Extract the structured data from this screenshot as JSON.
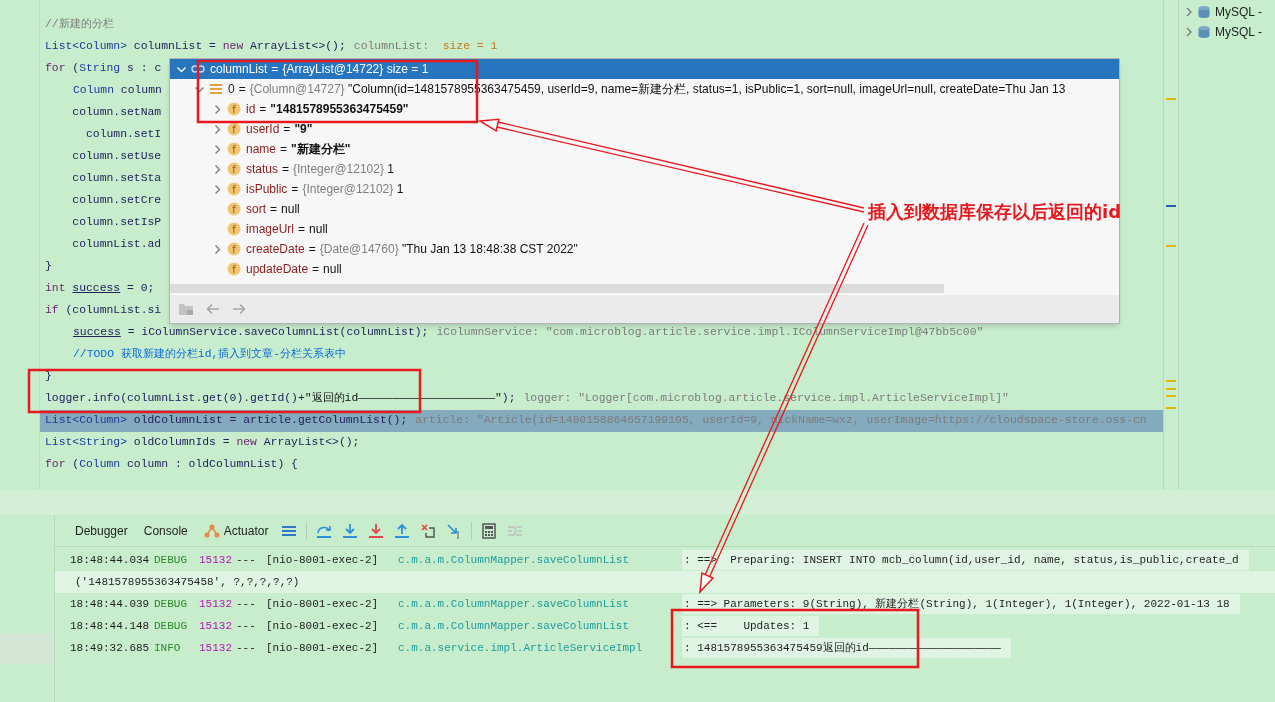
{
  "right_panel": {
    "items": [
      {
        "label": "MySQL -",
        "expanded": false
      },
      {
        "label": "MySQL -",
        "expanded": false
      }
    ]
  },
  "code_lines": [
    {
      "current": false,
      "code": [
        {
          "kind": "comment",
          "text": "//新建的分栏"
        }
      ]
    },
    {
      "current": false,
      "code": [
        {
          "kind": "type",
          "text": "List<Column>"
        },
        {
          "kind": "plain",
          "text": " columnList = "
        },
        {
          "kind": "keyword",
          "text": "new"
        },
        {
          "kind": "plain",
          "text": " ArrayList<>();"
        }
      ],
      "hint": [
        {
          "kind": "hint",
          "text": "columnList:  "
        },
        {
          "kind": "hint_value",
          "text": "size = 1"
        }
      ]
    },
    {
      "current": false,
      "code": [
        {
          "kind": "keyword",
          "text": "for"
        },
        {
          "kind": "plain",
          "text": " ("
        },
        {
          "kind": "type",
          "text": "String"
        },
        {
          "kind": "plain",
          "text": " s : c"
        }
      ]
    },
    {
      "current": false,
      "indented": true,
      "code": [
        {
          "kind": "type",
          "text": "Column"
        },
        {
          "kind": "plain",
          "text": " column"
        }
      ]
    },
    {
      "current": false,
      "code": [
        {
          "kind": "plain",
          "text": "    column.setNam"
        }
      ]
    },
    {
      "current": false,
      "code": [
        {
          "kind": "plain",
          "text": "      column.setI"
        }
      ]
    },
    {
      "current": false,
      "code": [
        {
          "kind": "plain",
          "text": "    column.setUse"
        }
      ]
    },
    {
      "current": false,
      "code": [
        {
          "kind": "plain",
          "text": "    column.setSta"
        }
      ]
    },
    {
      "current": false,
      "code": [
        {
          "kind": "plain",
          "text": "    column.setCre"
        }
      ]
    },
    {
      "current": false,
      "code": [
        {
          "kind": "plain",
          "text": "    column.setIsP"
        }
      ]
    },
    {
      "current": false,
      "code": [
        {
          "kind": "plain",
          "text": "    columnList.ad"
        }
      ]
    },
    {
      "current": false,
      "code": [
        {
          "kind": "plain",
          "text": "}"
        }
      ]
    },
    {
      "current": false,
      "code": [
        {
          "kind": "keyword",
          "text": "int "
        },
        {
          "kind": "underline",
          "text": "success"
        },
        {
          "kind": "plain",
          "text": " = 0;"
        }
      ]
    },
    {
      "current": false,
      "code": [
        {
          "kind": "keyword",
          "text": "if"
        },
        {
          "kind": "plain",
          "text": " (columnList.si"
        }
      ]
    },
    {
      "current": false,
      "indented": true,
      "code": [
        {
          "kind": "underline",
          "text": "success"
        },
        {
          "kind": "plain",
          "text": " = iColumnService.saveColumnList(columnList);"
        }
      ],
      "hint": [
        {
          "kind": "hint",
          "text": "iColumnService: \"com.microblog.article.service.impl.IColumnServiceImpl@47bb5c00\""
        }
      ]
    },
    {
      "current": false,
      "indented": true,
      "code": [
        {
          "kind": "todo",
          "text": "//TODO 获取新建的分栏id,插入到文章-分栏关系表中"
        }
      ]
    },
    {
      "current": false,
      "code": [
        {
          "kind": "plain",
          "text": "}"
        }
      ]
    },
    {
      "current": false,
      "code": [
        {
          "kind": "plain",
          "text": "logger.info(columnList.get(0).getId()+"
        },
        {
          "kind": "string",
          "text": "\"返回的id————————————————————\""
        },
        {
          "kind": "plain",
          "text": ");"
        }
      ],
      "hint": [
        {
          "kind": "hint",
          "text": "logger: \"Logger[com.microblog.article.service.impl.ArticleServiceImpl]\""
        }
      ]
    },
    {
      "current": true,
      "code": [
        {
          "kind": "type",
          "text": "List<Column>"
        },
        {
          "kind": "plain",
          "text": " oldColumnList = article.getColumnList();"
        }
      ],
      "hint": [
        {
          "kind": "hint",
          "text": "article: \"Article(id=1480158864657199105, userId=9, nickName=wxz, userImage=https://cloudspace-store.oss-cn"
        }
      ]
    },
    {
      "current": false,
      "code": [
        {
          "kind": "type",
          "text": "List<String>"
        },
        {
          "kind": "plain",
          "text": " oldColumnIds = "
        },
        {
          "kind": "keyword",
          "text": "new"
        },
        {
          "kind": "plain",
          "text": " ArrayList<>();"
        }
      ]
    },
    {
      "current": false,
      "code": [
        {
          "kind": "keyword",
          "text": "for"
        },
        {
          "kind": "plain",
          "text": " ("
        },
        {
          "kind": "type",
          "text": "Column"
        },
        {
          "kind": "plain",
          "text": " column : oldColumnList) {"
        }
      ]
    }
  ],
  "variables_popup": {
    "root": {
      "kind": "list",
      "name": "columnList",
      "eq": "=",
      "ref": "{ArrayList@14722}",
      "value": "size = 1",
      "expandable": true,
      "expanded": true,
      "children": [
        {
          "kind": "object",
          "name": "0",
          "eq": "=",
          "ref": "{Column@14727}",
          "value": "\"Column(id=1481578955363475459, userId=9, name=新建分栏, status=1, isPublic=1, sort=null, imageUrl=null, createDate=Thu Jan 13",
          "expandable": true,
          "expanded": true,
          "children": [
            {
              "kind": "string_field",
              "badge": "f",
              "name": "id",
              "eq": "=",
              "value": "\"1481578955363475459\"",
              "expandable": true,
              "expanded": false
            },
            {
              "kind": "string_field",
              "badge": "f",
              "name": "userId",
              "eq": "=",
              "value": "\"9\"",
              "expandable": true,
              "expanded": false
            },
            {
              "kind": "string_field",
              "badge": "f",
              "name": "name",
              "eq": "=",
              "value": "\"新建分栏\"",
              "expandable": true,
              "expanded": false
            },
            {
              "kind": "field",
              "badge": "f",
              "name": "status",
              "eq": "=",
              "ref": "{Integer@12102}",
              "value": "1",
              "expandable": true,
              "expanded": false
            },
            {
              "kind": "field",
              "badge": "f",
              "name": "isPublic",
              "eq": "=",
              "ref": "{Integer@12102}",
              "value": "1",
              "expandable": true,
              "expanded": false
            },
            {
              "kind": "field",
              "badge": "f",
              "name": "sort",
              "eq": "=",
              "value": "null",
              "expandable": false
            },
            {
              "kind": "field",
              "badge": "f",
              "name": "imageUrl",
              "eq": "=",
              "value": "null",
              "expandable": false
            },
            {
              "kind": "field",
              "badge": "f",
              "name": "createDate",
              "eq": "=",
              "ref": "{Date@14760}",
              "value": "\"Thu Jan 13 18:48:38 CST 2022\"",
              "expandable": true,
              "expanded": false
            },
            {
              "kind": "field",
              "badge": "f",
              "name": "updateDate",
              "eq": "=",
              "value": "null",
              "expandable": false
            }
          ]
        }
      ]
    }
  },
  "annotation": {
    "label": "插入到数据库保存以后返回的id"
  },
  "debug_panel": {
    "tabs": [
      {
        "label": "Debugger"
      },
      {
        "label": "Console"
      },
      {
        "label": "Actuator",
        "kind": "actuator"
      }
    ],
    "console": [
      {
        "kind": "log",
        "time": "18:48:44.034",
        "level": "DEBUG",
        "pid": "15132",
        "sep": "---",
        "thread": "[nio-8001-exec-2]",
        "logger": "c.m.a.m.ColumnMapper.saveColumnList",
        "message": ": ==>  Preparing: INSERT INTO mcb_column(id,user_id, name, status,is_public,create_d"
      },
      {
        "kind": "continuation",
        "text": "('1481578955363475458', ?,?,?,?,?)"
      },
      {
        "kind": "log",
        "time": "18:48:44.039",
        "level": "DEBUG",
        "pid": "15132",
        "sep": "---",
        "thread": "[nio-8001-exec-2]",
        "logger": "c.m.a.m.ColumnMapper.saveColumnList",
        "message": ": ==> Parameters: 9(String), 新建分栏(String), 1(Integer), 1(Integer), 2022-01-13 18"
      },
      {
        "kind": "log",
        "time": "18:48:44.148",
        "level": "DEBUG",
        "pid": "15132",
        "sep": "---",
        "thread": "[nio-8001-exec-2]",
        "logger": "c.m.a.m.ColumnMapper.saveColumnList",
        "message": ": <==    Updates: 1"
      },
      {
        "kind": "log",
        "time": "18:49:32.685",
        "level": "INFO",
        "pid": "15132",
        "sep": "---",
        "thread": "[nio-8001-exec-2]",
        "logger": "c.m.a.service.impl.ArticleServiceImpl",
        "message": ": 1481578955363475459返回的id————————————————————"
      }
    ]
  }
}
